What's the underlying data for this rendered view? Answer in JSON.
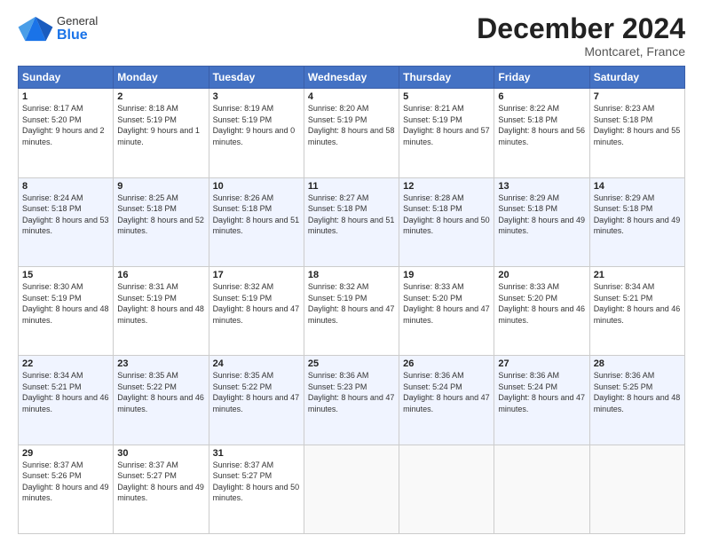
{
  "header": {
    "logo_general": "General",
    "logo_blue": "Blue",
    "title": "December 2024",
    "location": "Montcaret, France"
  },
  "days_of_week": [
    "Sunday",
    "Monday",
    "Tuesday",
    "Wednesday",
    "Thursday",
    "Friday",
    "Saturday"
  ],
  "weeks": [
    [
      {
        "day": 1,
        "info": "Sunrise: 8:17 AM\nSunset: 5:20 PM\nDaylight: 9 hours and 2 minutes."
      },
      {
        "day": 2,
        "info": "Sunrise: 8:18 AM\nSunset: 5:19 PM\nDaylight: 9 hours and 1 minute."
      },
      {
        "day": 3,
        "info": "Sunrise: 8:19 AM\nSunset: 5:19 PM\nDaylight: 9 hours and 0 minutes."
      },
      {
        "day": 4,
        "info": "Sunrise: 8:20 AM\nSunset: 5:19 PM\nDaylight: 8 hours and 58 minutes."
      },
      {
        "day": 5,
        "info": "Sunrise: 8:21 AM\nSunset: 5:19 PM\nDaylight: 8 hours and 57 minutes."
      },
      {
        "day": 6,
        "info": "Sunrise: 8:22 AM\nSunset: 5:18 PM\nDaylight: 8 hours and 56 minutes."
      },
      {
        "day": 7,
        "info": "Sunrise: 8:23 AM\nSunset: 5:18 PM\nDaylight: 8 hours and 55 minutes."
      }
    ],
    [
      {
        "day": 8,
        "info": "Sunrise: 8:24 AM\nSunset: 5:18 PM\nDaylight: 8 hours and 53 minutes."
      },
      {
        "day": 9,
        "info": "Sunrise: 8:25 AM\nSunset: 5:18 PM\nDaylight: 8 hours and 52 minutes."
      },
      {
        "day": 10,
        "info": "Sunrise: 8:26 AM\nSunset: 5:18 PM\nDaylight: 8 hours and 51 minutes."
      },
      {
        "day": 11,
        "info": "Sunrise: 8:27 AM\nSunset: 5:18 PM\nDaylight: 8 hours and 51 minutes."
      },
      {
        "day": 12,
        "info": "Sunrise: 8:28 AM\nSunset: 5:18 PM\nDaylight: 8 hours and 50 minutes."
      },
      {
        "day": 13,
        "info": "Sunrise: 8:29 AM\nSunset: 5:18 PM\nDaylight: 8 hours and 49 minutes."
      },
      {
        "day": 14,
        "info": "Sunrise: 8:29 AM\nSunset: 5:18 PM\nDaylight: 8 hours and 49 minutes."
      }
    ],
    [
      {
        "day": 15,
        "info": "Sunrise: 8:30 AM\nSunset: 5:19 PM\nDaylight: 8 hours and 48 minutes."
      },
      {
        "day": 16,
        "info": "Sunrise: 8:31 AM\nSunset: 5:19 PM\nDaylight: 8 hours and 48 minutes."
      },
      {
        "day": 17,
        "info": "Sunrise: 8:32 AM\nSunset: 5:19 PM\nDaylight: 8 hours and 47 minutes."
      },
      {
        "day": 18,
        "info": "Sunrise: 8:32 AM\nSunset: 5:19 PM\nDaylight: 8 hours and 47 minutes."
      },
      {
        "day": 19,
        "info": "Sunrise: 8:33 AM\nSunset: 5:20 PM\nDaylight: 8 hours and 47 minutes."
      },
      {
        "day": 20,
        "info": "Sunrise: 8:33 AM\nSunset: 5:20 PM\nDaylight: 8 hours and 46 minutes."
      },
      {
        "day": 21,
        "info": "Sunrise: 8:34 AM\nSunset: 5:21 PM\nDaylight: 8 hours and 46 minutes."
      }
    ],
    [
      {
        "day": 22,
        "info": "Sunrise: 8:34 AM\nSunset: 5:21 PM\nDaylight: 8 hours and 46 minutes."
      },
      {
        "day": 23,
        "info": "Sunrise: 8:35 AM\nSunset: 5:22 PM\nDaylight: 8 hours and 46 minutes."
      },
      {
        "day": 24,
        "info": "Sunrise: 8:35 AM\nSunset: 5:22 PM\nDaylight: 8 hours and 47 minutes."
      },
      {
        "day": 25,
        "info": "Sunrise: 8:36 AM\nSunset: 5:23 PM\nDaylight: 8 hours and 47 minutes."
      },
      {
        "day": 26,
        "info": "Sunrise: 8:36 AM\nSunset: 5:24 PM\nDaylight: 8 hours and 47 minutes."
      },
      {
        "day": 27,
        "info": "Sunrise: 8:36 AM\nSunset: 5:24 PM\nDaylight: 8 hours and 47 minutes."
      },
      {
        "day": 28,
        "info": "Sunrise: 8:36 AM\nSunset: 5:25 PM\nDaylight: 8 hours and 48 minutes."
      }
    ],
    [
      {
        "day": 29,
        "info": "Sunrise: 8:37 AM\nSunset: 5:26 PM\nDaylight: 8 hours and 49 minutes."
      },
      {
        "day": 30,
        "info": "Sunrise: 8:37 AM\nSunset: 5:27 PM\nDaylight: 8 hours and 49 minutes."
      },
      {
        "day": 31,
        "info": "Sunrise: 8:37 AM\nSunset: 5:27 PM\nDaylight: 8 hours and 50 minutes."
      },
      null,
      null,
      null,
      null
    ]
  ]
}
